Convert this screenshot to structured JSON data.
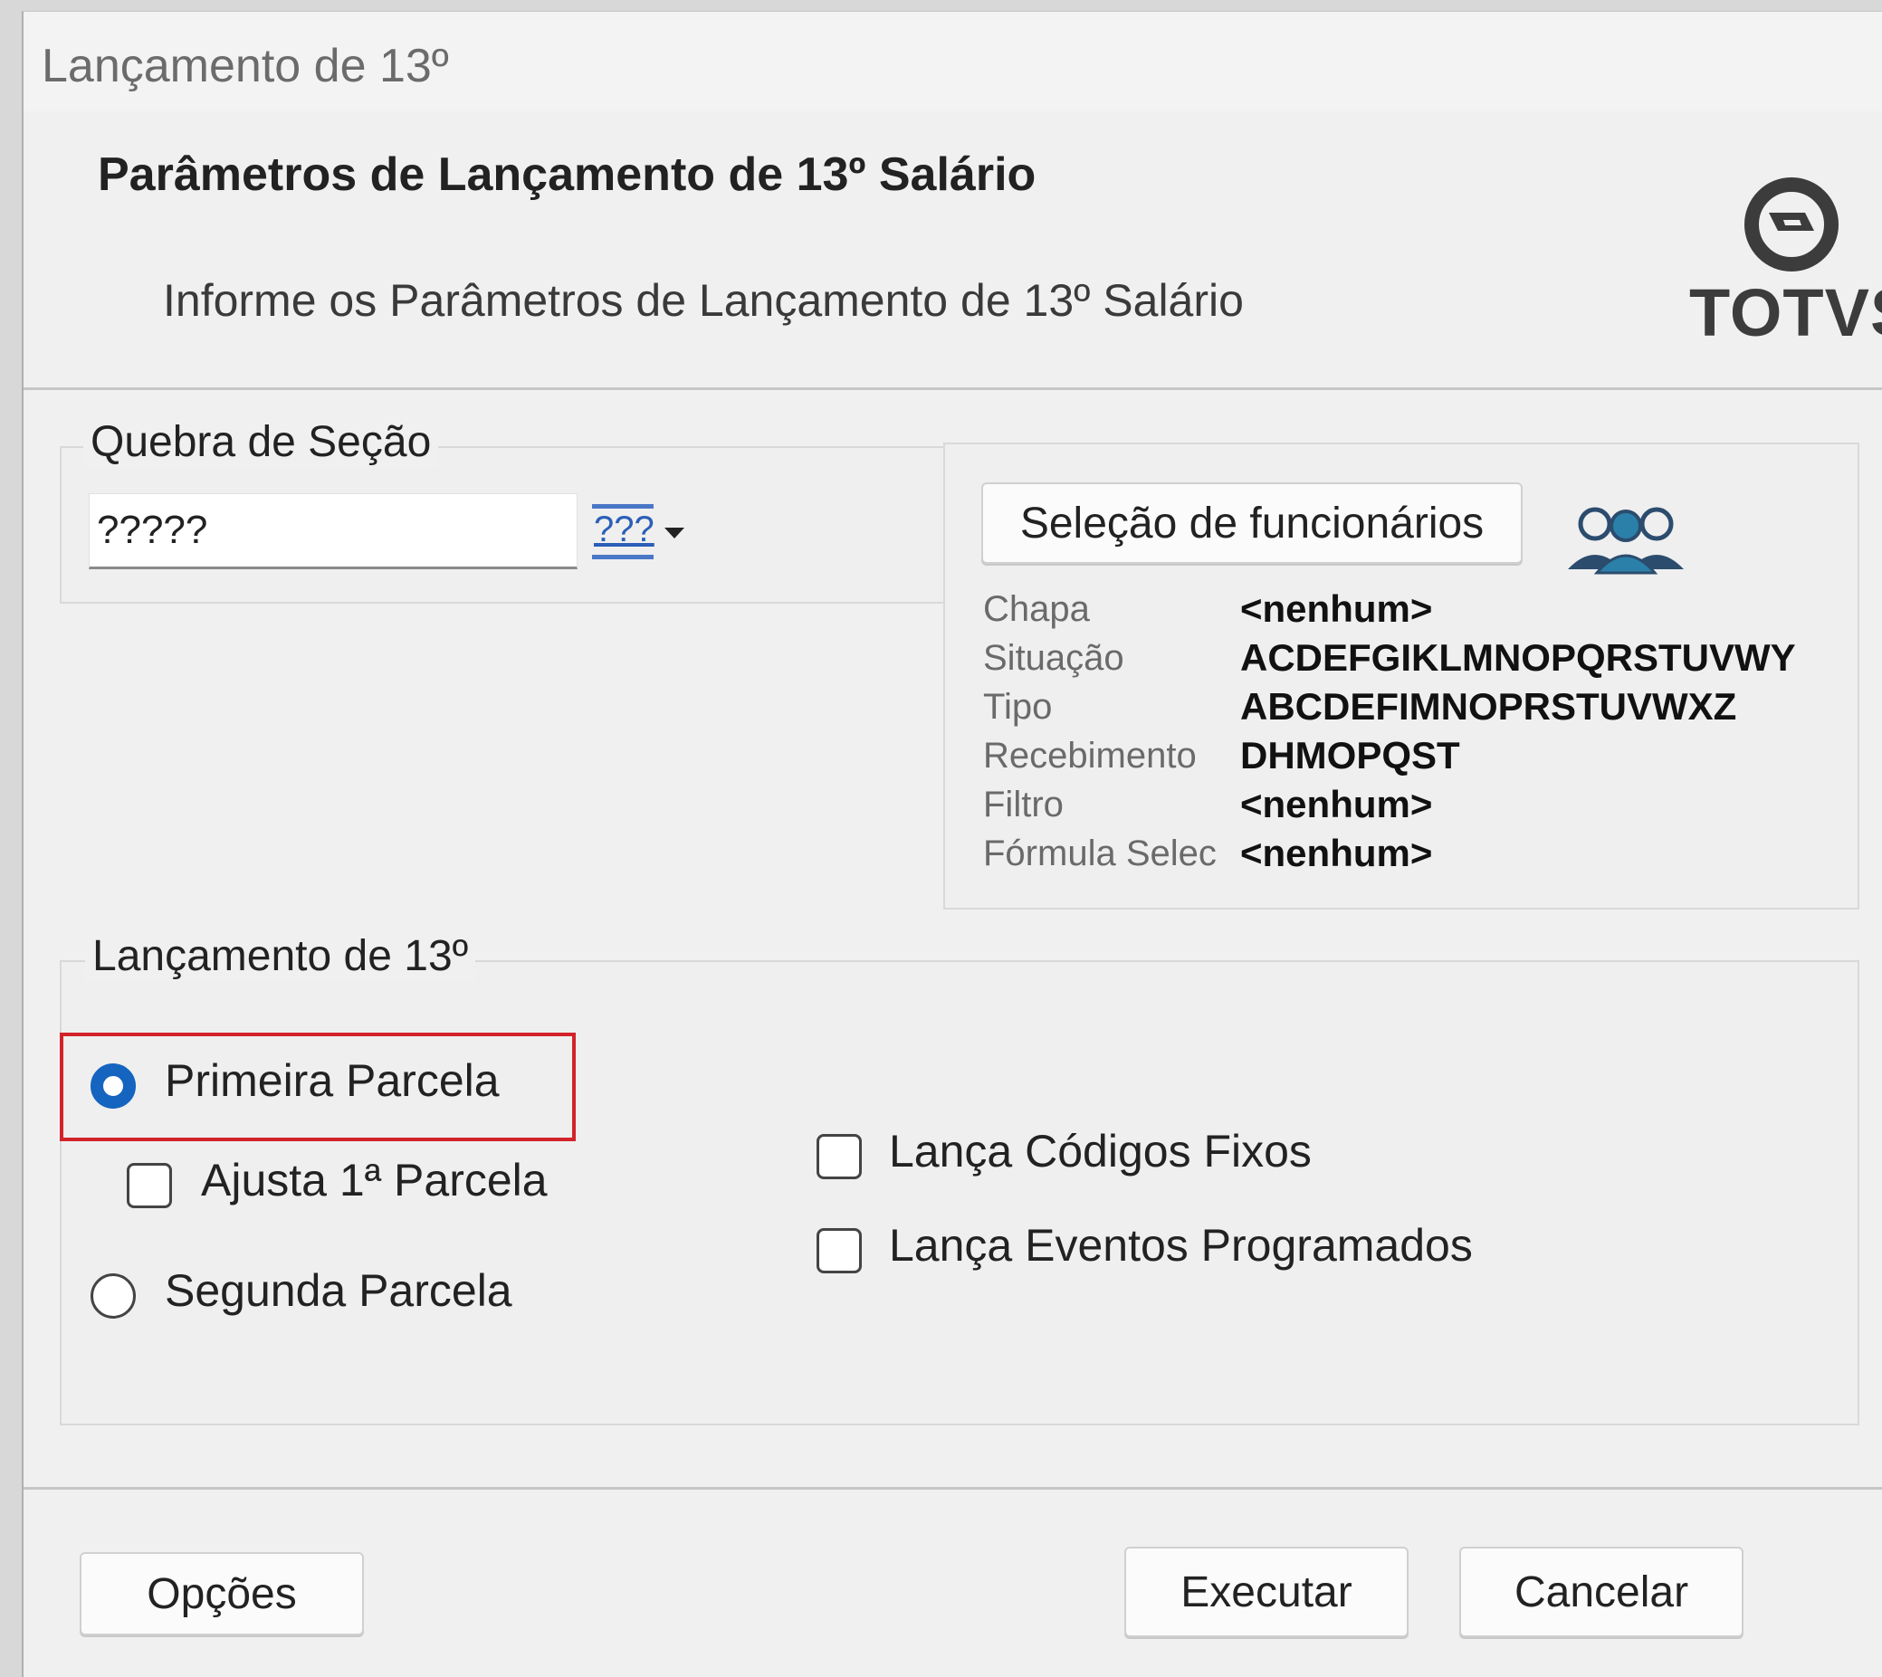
{
  "window": {
    "title": "Lançamento de 13º"
  },
  "header": {
    "title": "Parâmetros de Lançamento de 13º Salário",
    "subtitle": "Informe os Parâmetros de Lançamento de 13º Salário",
    "logo_text": "TOTVS",
    "logo_icon": "totvs-logo-icon"
  },
  "section_break": {
    "legend": "Quebra de Seção",
    "value": "?????",
    "dropdown_label": "???",
    "dropdown_icon": "chevron-down-icon"
  },
  "employees": {
    "button_label": "Seleção de funcionários",
    "icon": "users-group-icon",
    "rows": [
      {
        "label": "Chapa",
        "value": "<nenhum>"
      },
      {
        "label": "Situação",
        "value": "ACDEFGIKLMNOPQRSTUVWY"
      },
      {
        "label": "Tipo",
        "value": "ABCDEFIMNOPRSTUVWXZ"
      },
      {
        "label": "Recebimento",
        "value": "DHMOPQST"
      },
      {
        "label": "Filtro",
        "value": "<nenhum>"
      },
      {
        "label": "Fórmula Selec",
        "value": "<nenhum>"
      }
    ]
  },
  "launch": {
    "legend": "Lançamento de 13º",
    "first_installment": "Primeira Parcela",
    "adjust_first": "Ajusta 1ª Parcela",
    "second_installment": "Segunda Parcela",
    "fixed_codes": "Lança Códigos Fixos",
    "scheduled_events": "Lança Eventos Programados",
    "selected": "Primeira Parcela",
    "highlight_color": "#d2232a",
    "accent_color": "#1564c0"
  },
  "footer": {
    "options_label": "Opções",
    "execute_label": "Executar",
    "cancel_label": "Cancelar"
  }
}
